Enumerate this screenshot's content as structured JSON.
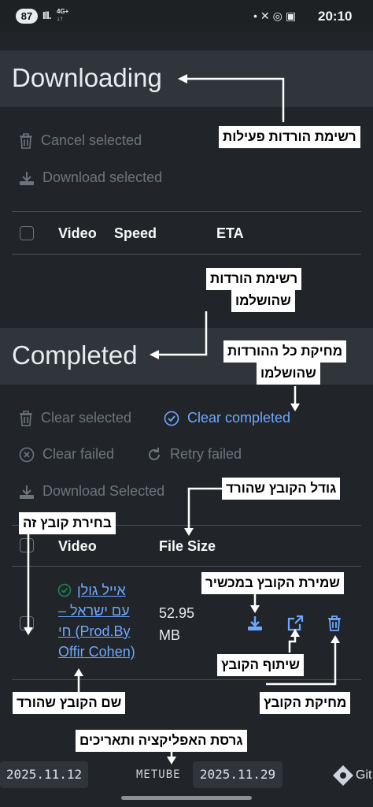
{
  "status_bar": {
    "battery": "87",
    "signal": "Ill.",
    "network": "4G+",
    "network_sub": "↓↑",
    "time": "20:10"
  },
  "downloading": {
    "title": "Downloading",
    "cancel_selected": "Cancel selected",
    "download_selected": "Download selected",
    "columns": [
      "Video",
      "Speed",
      "ETA"
    ]
  },
  "completed": {
    "title": "Completed",
    "clear_selected": "Clear selected",
    "clear_completed": "Clear completed",
    "clear_failed": "Clear failed",
    "retry_failed": "Retry failed",
    "download_selected": "Download Selected",
    "columns": [
      "Video",
      "File Size"
    ],
    "items": [
      {
        "name": "אייל גולן – עם ישראל חי (Prod.By Offir Cohen)",
        "name_lines": [
          "אייל גולן",
          "– עם ישראל",
          "חי (Prod.By",
          "Offir Cohen)"
        ],
        "size_lines": [
          "52.95",
          "MB"
        ],
        "status": "success"
      }
    ]
  },
  "footer": {
    "version_left": "2025.11.12",
    "brand": "METUBE",
    "version_right": "2025.11.29",
    "git": "Git"
  },
  "annotations": {
    "active_list": "רשימת הורדות פעילות",
    "completed_list_1": "רשימת הורדות",
    "completed_list_2": "שהושלמו",
    "clear_all_1": "מחיקת כל ההורדות",
    "clear_all_2": "שהושלמו",
    "file_size": "גודל הקובץ שהורד",
    "select_file": "בחירת קובץ זה",
    "save_file": "שמירת הקובץ במכשיר",
    "share_file": "שיתוף הקובץ",
    "file_name": "שם הקובץ שהורד",
    "delete_file": "מחיקת הקובץ",
    "versions": "גרסת האפליקציה ותאריכים"
  },
  "colors": {
    "background": "#212529",
    "header": "#2f353b",
    "accent": "#6ea8fe",
    "success": "#198754",
    "muted": "#6c757d"
  },
  "icons": [
    "trash-icon",
    "download-icon",
    "check-circle-icon",
    "x-circle-icon",
    "retry-icon",
    "share-icon",
    "git-icon"
  ]
}
